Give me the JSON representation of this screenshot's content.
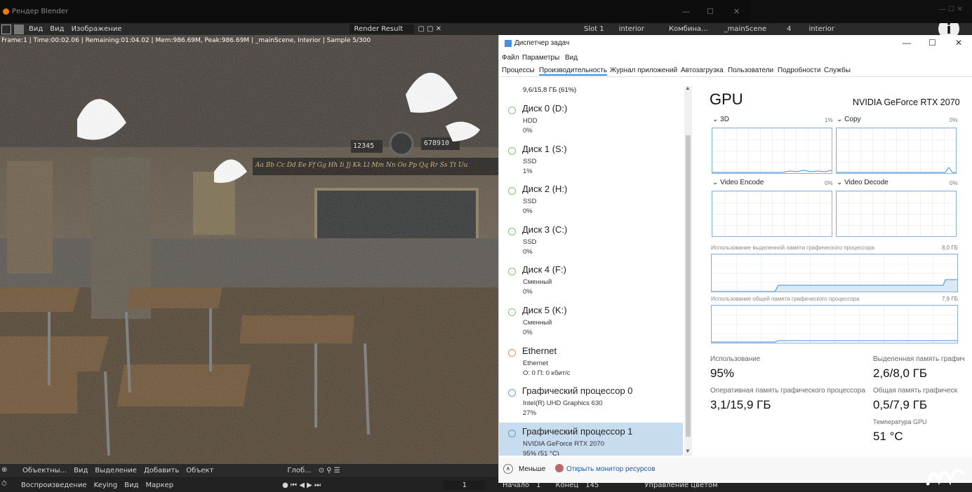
{
  "blender": {
    "window_title": "Рендер Blender",
    "menu": [
      "Вид",
      "Вид",
      "Изображение"
    ],
    "image_name": "Render Result",
    "right_header": {
      "slot": "Slot 1",
      "layer": "interior",
      "view": "Комбина...",
      "scene": "_mainScene",
      "count": "4",
      "layer2": "interior"
    },
    "status": "Frame:1 | Time:00:02.06 | Remaining:01:04.02 | Mem:986.69M, Peak:986.69M | _mainScene, Interior | Sample 5/300",
    "footer1": [
      "Объектны...",
      "Вид",
      "Выделение",
      "Добавить",
      "Объект",
      "Глоб..."
    ],
    "footer2": [
      "Воспроизведение",
      "Keying",
      "Вид",
      "Маркер"
    ],
    "timeline": {
      "current": "1",
      "start_label": "Начало",
      "start": "1",
      "end_label": "Конец",
      "end": "145",
      "color_mgmt": "Управление цветом"
    },
    "scene_numbers": [
      "12345",
      "678910"
    ],
    "alphabet": "Aa Bb Cc Dd Ee Ff Gg Hh Ii Jj Kk Ll Mm Nn Oo Pp Qq Rr Ss Tt Uu"
  },
  "taskmgr": {
    "title": "Диспетчер задач",
    "menu": [
      "Файл",
      "Параметры",
      "Вид"
    ],
    "tabs": [
      "Процессы",
      "Производительность",
      "Журнал приложений",
      "Автозагрузка",
      "Пользователи",
      "Подробности",
      "Службы"
    ],
    "top_memory": "9,6/15,8 ГБ (61%)",
    "items": [
      {
        "name": "Диск 0 (D:)",
        "sub1": "HDD",
        "sub2": "0%",
        "kind": "disk"
      },
      {
        "name": "Диск 1 (S:)",
        "sub1": "SSD",
        "sub2": "1%",
        "kind": "disk"
      },
      {
        "name": "Диск 2 (H:)",
        "sub1": "SSD",
        "sub2": "0%",
        "kind": "disk"
      },
      {
        "name": "Диск 3 (C:)",
        "sub1": "SSD",
        "sub2": "0%",
        "kind": "disk"
      },
      {
        "name": "Диск 4 (F:)",
        "sub1": "Сменный",
        "sub2": "0%",
        "kind": "disk"
      },
      {
        "name": "Диск 5 (K:)",
        "sub1": "Сменный",
        "sub2": "0%",
        "kind": "disk"
      },
      {
        "name": "Ethernet",
        "sub1": "Ethernet",
        "sub2": "О: 0 П: 0 кбит/с",
        "kind": "net"
      },
      {
        "name": "Графический процессор 0",
        "sub1": "Intel(R) UHD Graphics 630",
        "sub2": "27%",
        "kind": "gpu"
      },
      {
        "name": "Графический процессор 1",
        "sub1": "NVIDIA GeForce RTX 2070",
        "sub2": "95% (51 °C)",
        "kind": "gpu"
      }
    ],
    "gpu": {
      "title": "GPU",
      "model": "NVIDIA GeForce RTX 2070",
      "engines": [
        {
          "name": "3D",
          "pct": "1%"
        },
        {
          "name": "Copy",
          "pct": "0%"
        },
        {
          "name": "Video Encode",
          "pct": "0%"
        },
        {
          "name": "Video Decode",
          "pct": "0%"
        }
      ],
      "ded_mem_label": "Использование выделенной памяти графического процессора",
      "ded_mem_max": "8,0 ГБ",
      "shared_mem_label": "Использование общей памяти графического процессора",
      "shared_mem_max": "7,9 ГБ",
      "stats": [
        {
          "label": "Использование",
          "value": "95%"
        },
        {
          "label": "Выделенная память графич",
          "value": "2,6/8,0 ГБ"
        },
        {
          "label": "Оперативная память графического процессора",
          "value": "3,1/15,9 ГБ"
        },
        {
          "label": "Общая память графическ",
          "value": "0,5/7,9 ГБ"
        },
        {
          "label": "Температура GPU",
          "value": "51 °C"
        }
      ]
    },
    "less": "Меньше",
    "resmon": "Открыть монитор ресурсов",
    "win_controls": [
      "—",
      "☐",
      "✕"
    ]
  }
}
